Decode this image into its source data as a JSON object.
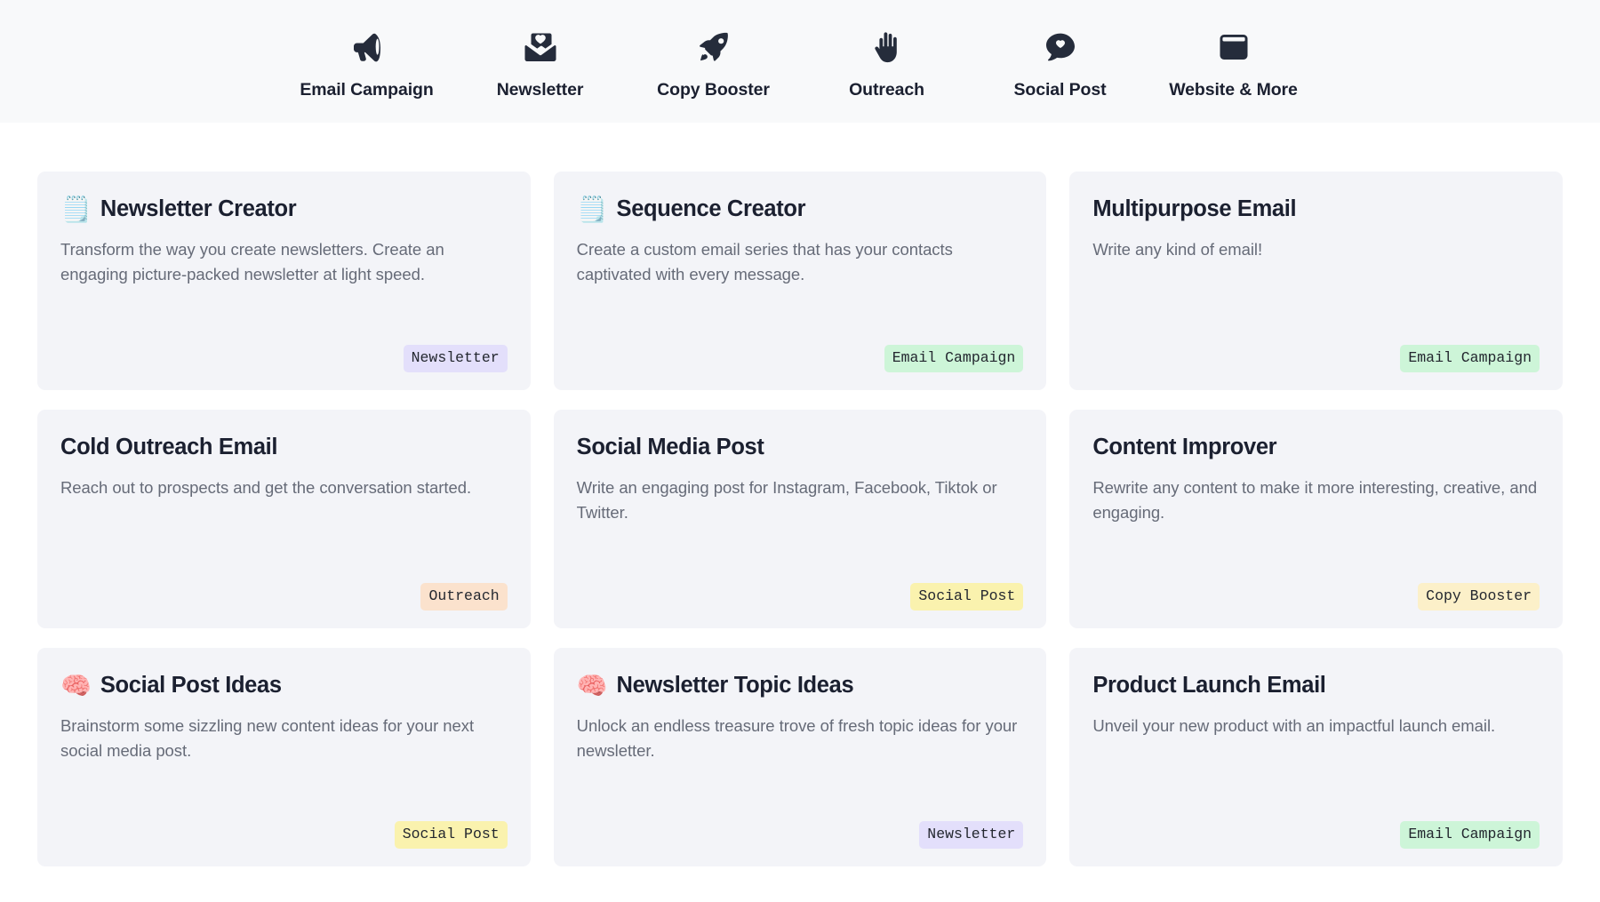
{
  "categories": [
    {
      "label": "Email Campaign",
      "icon": "megaphone-icon"
    },
    {
      "label": "Newsletter",
      "icon": "envelope-heart-icon"
    },
    {
      "label": "Copy Booster",
      "icon": "rocket-icon"
    },
    {
      "label": "Outreach",
      "icon": "hand-wave-icon"
    },
    {
      "label": "Social Post",
      "icon": "speech-bubble-heart-icon"
    },
    {
      "label": "Website & More",
      "icon": "browser-window-icon"
    }
  ],
  "cards": [
    {
      "emoji": "🗒️",
      "emoji_name": "spiral-notepad-icon",
      "title": "Newsletter Creator",
      "description": "Transform the way you create newsletters. Create an engaging picture-packed newsletter at light speed.",
      "badge": "Newsletter",
      "badge_class": "badge-newsletter",
      "badge_color": "#e3dffb"
    },
    {
      "emoji": "🗒️",
      "emoji_name": "spiral-notepad-icon",
      "title": "Sequence Creator",
      "description": "Create a custom email series that has your contacts captivated with every message.",
      "badge": "Email Campaign",
      "badge_class": "badge-email-campaign",
      "badge_color": "#cdf5d8"
    },
    {
      "emoji": "",
      "emoji_name": "",
      "title": "Multipurpose Email",
      "description": "Write any kind of email!",
      "badge": "Email Campaign",
      "badge_class": "badge-email-campaign",
      "badge_color": "#cdf5d8"
    },
    {
      "emoji": "",
      "emoji_name": "",
      "title": "Cold Outreach Email",
      "description": "Reach out to prospects and get the conversation started.",
      "badge": "Outreach",
      "badge_class": "badge-outreach",
      "badge_color": "#fbe2cd"
    },
    {
      "emoji": "",
      "emoji_name": "",
      "title": "Social Media Post",
      "description": "Write an engaging post for Instagram, Facebook, Tiktok or Twitter.",
      "badge": "Social Post",
      "badge_class": "badge-social-post",
      "badge_color": "#faf2ae"
    },
    {
      "emoji": "",
      "emoji_name": "",
      "title": "Content Improver",
      "description": "Rewrite any content to make it more interesting, creative, and engaging.",
      "badge": "Copy Booster",
      "badge_class": "badge-copy-booster",
      "badge_color": "#fcf0c9"
    },
    {
      "emoji": "🧠",
      "emoji_name": "brain-icon",
      "title": "Social Post Ideas",
      "description": "Brainstorm some sizzling new content ideas for your next social media post.",
      "badge": "Social Post",
      "badge_class": "badge-social-post",
      "badge_color": "#faf2ae"
    },
    {
      "emoji": "🧠",
      "emoji_name": "brain-icon",
      "title": "Newsletter Topic Ideas",
      "description": "Unlock an endless treasure trove of fresh topic ideas for your newsletter.",
      "badge": "Newsletter",
      "badge_class": "badge-newsletter",
      "badge_color": "#e3dffb"
    },
    {
      "emoji": "",
      "emoji_name": "",
      "title": "Product Launch Email",
      "description": "Unveil your new product with an impactful launch email.",
      "badge": "Email Campaign",
      "badge_class": "badge-email-campaign",
      "badge_color": "#cdf5d8"
    }
  ],
  "theme": {
    "topbar_background": "#f8f9fa",
    "page_background": "#ffffff",
    "card_background": "#f3f4f8",
    "title_color": "#1b2030",
    "description_color": "#666b78",
    "icon_color": "#252c3b"
  }
}
